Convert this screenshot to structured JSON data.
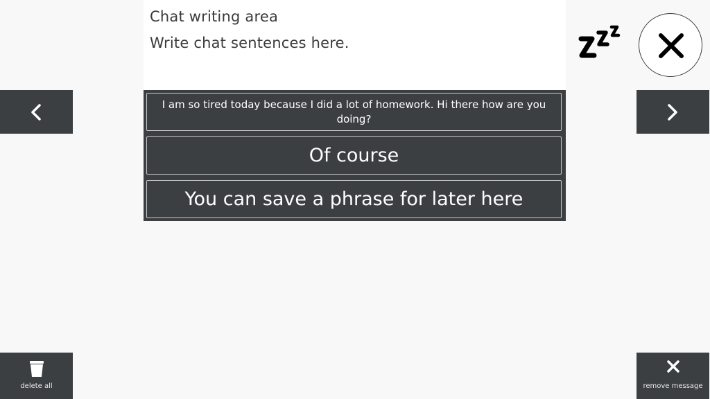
{
  "writing_area": {
    "title": "Chat writing area",
    "placeholder": "Write chat sentences here."
  },
  "top_controls": {
    "sleep_icon": "zzz-icon",
    "close_icon": "close-icon"
  },
  "navigation": {
    "prev_icon": "chevron-left-icon",
    "next_icon": "chevron-right-icon"
  },
  "phrases": [
    {
      "text": "I am so tired today because I did a lot of homework. Hi there how are you doing?"
    },
    {
      "text": "Of course"
    },
    {
      "text": "You can save a phrase for later here"
    }
  ],
  "bottom_controls": {
    "delete_all_label": "delete all",
    "delete_all_icon": "trash-icon",
    "remove_message_label": "remove message",
    "remove_message_icon": "close-icon"
  },
  "colors": {
    "panel": "#3c3f42",
    "background": "#f8f8f8",
    "text_dark": "#3b3b3b",
    "text_light": "#ffffff"
  }
}
